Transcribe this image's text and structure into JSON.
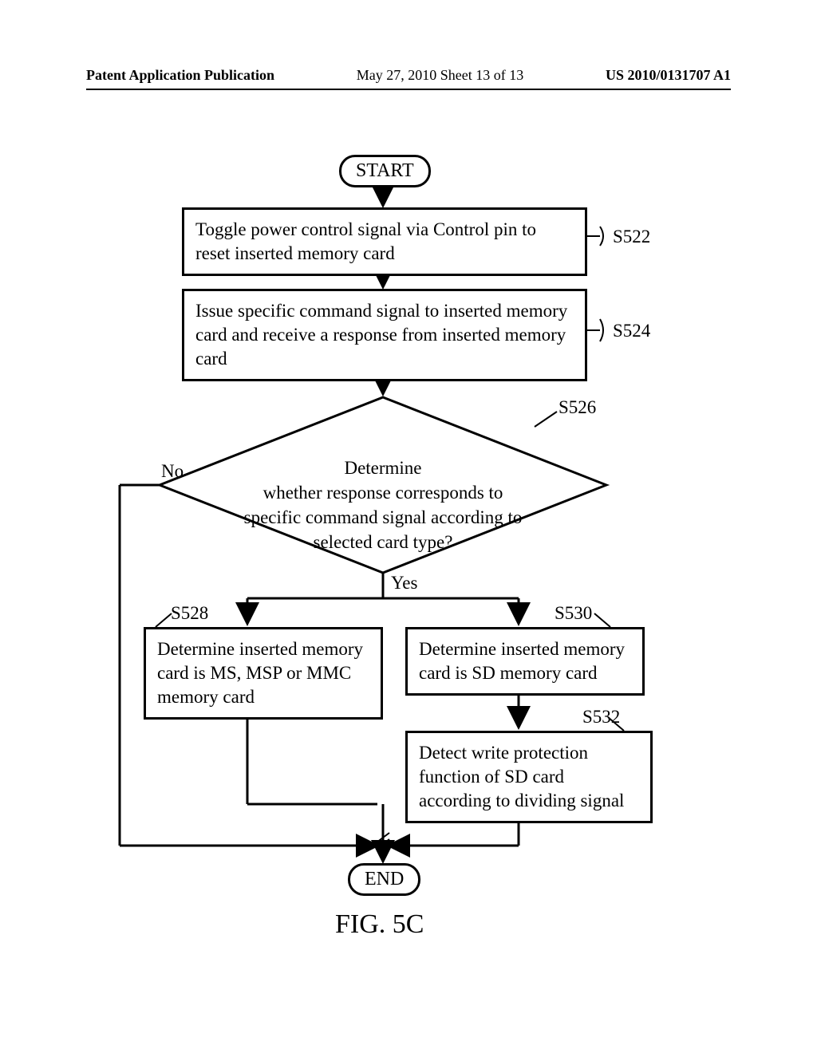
{
  "header": {
    "left": "Patent Application Publication",
    "center": "May 27, 2010  Sheet 13 of 13",
    "right": "US 2010/0131707 A1"
  },
  "flow": {
    "start": "START",
    "s522": {
      "text": "Toggle power control signal via Control pin to reset inserted memory card",
      "ref": "S522"
    },
    "s524": {
      "text": "Issue specific command signal to inserted memory card and receive a response from inserted memory card",
      "ref": "S524"
    },
    "s526": {
      "text": "Determine\nwhether response corresponds to\nspecific command signal according to\nselected card type?",
      "ref": "S526",
      "no": "No",
      "yes": "Yes"
    },
    "s528": {
      "text": "Determine inserted memory card is MS, MSP or MMC memory card",
      "ref": "S528"
    },
    "s530": {
      "text": "Determine inserted memory card is SD memory card",
      "ref": "S530"
    },
    "s532": {
      "text": "Detect write protection function of SD card according to dividing signal",
      "ref": "S532"
    },
    "end": "END"
  },
  "figure": "FIG.  5C"
}
